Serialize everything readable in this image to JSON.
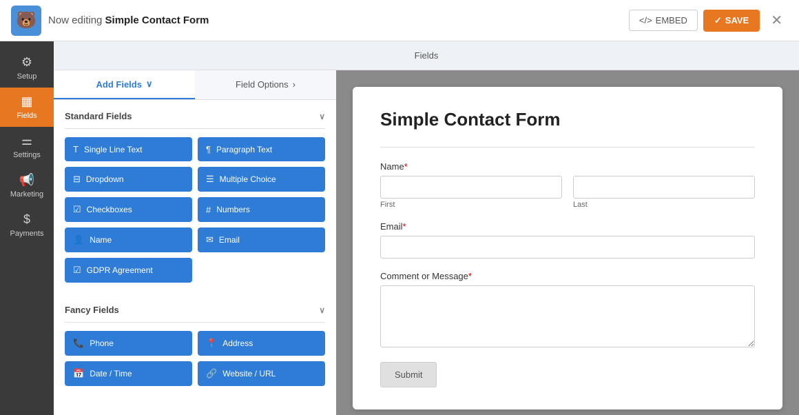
{
  "topbar": {
    "editing_prefix": "Now editing ",
    "form_name": "Simple Contact Form",
    "embed_label": "EMBED",
    "save_label": "SAVE",
    "close_label": "✕"
  },
  "sidebar": {
    "items": [
      {
        "id": "setup",
        "label": "Setup",
        "icon": "⚙"
      },
      {
        "id": "fields",
        "label": "Fields",
        "icon": "▦",
        "active": true
      },
      {
        "id": "settings",
        "label": "Settings",
        "icon": "≡"
      },
      {
        "id": "marketing",
        "label": "Marketing",
        "icon": "📢"
      },
      {
        "id": "payments",
        "label": "Payments",
        "icon": "$"
      }
    ]
  },
  "fields_header": {
    "label": "Fields"
  },
  "panel": {
    "tabs": [
      {
        "id": "add-fields",
        "label": "Add Fields",
        "active": true,
        "chevron": "∨"
      },
      {
        "id": "field-options",
        "label": "Field Options",
        "active": false,
        "chevron": "›"
      }
    ]
  },
  "standard_fields": {
    "section_title": "Standard Fields",
    "buttons": [
      {
        "id": "single-line-text",
        "icon": "T",
        "label": "Single Line Text"
      },
      {
        "id": "paragraph-text",
        "icon": "¶",
        "label": "Paragraph Text"
      },
      {
        "id": "dropdown",
        "icon": "⊟",
        "label": "Dropdown"
      },
      {
        "id": "multiple-choice",
        "icon": "☰",
        "label": "Multiple Choice"
      },
      {
        "id": "checkboxes",
        "icon": "☑",
        "label": "Checkboxes"
      },
      {
        "id": "numbers",
        "icon": "#",
        "label": "Numbers"
      },
      {
        "id": "name",
        "icon": "👤",
        "label": "Name"
      },
      {
        "id": "email",
        "icon": "✉",
        "label": "Email"
      },
      {
        "id": "gdpr",
        "icon": "☑",
        "label": "GDPR Agreement",
        "full": true
      }
    ]
  },
  "fancy_fields": {
    "section_title": "Fancy Fields",
    "buttons": [
      {
        "id": "phone",
        "icon": "📞",
        "label": "Phone"
      },
      {
        "id": "address",
        "icon": "📍",
        "label": "Address"
      },
      {
        "id": "datetime",
        "icon": "📅",
        "label": "Date / Time"
      },
      {
        "id": "website",
        "icon": "🔗",
        "label": "Website / URL"
      }
    ]
  },
  "form_preview": {
    "title": "Simple Contact Form",
    "fields": [
      {
        "id": "name",
        "label": "Name",
        "required": true,
        "type": "name",
        "sub_labels": [
          "First",
          "Last"
        ]
      },
      {
        "id": "email",
        "label": "Email",
        "required": true,
        "type": "email"
      },
      {
        "id": "message",
        "label": "Comment or Message",
        "required": true,
        "type": "textarea"
      }
    ],
    "submit_label": "Submit"
  }
}
